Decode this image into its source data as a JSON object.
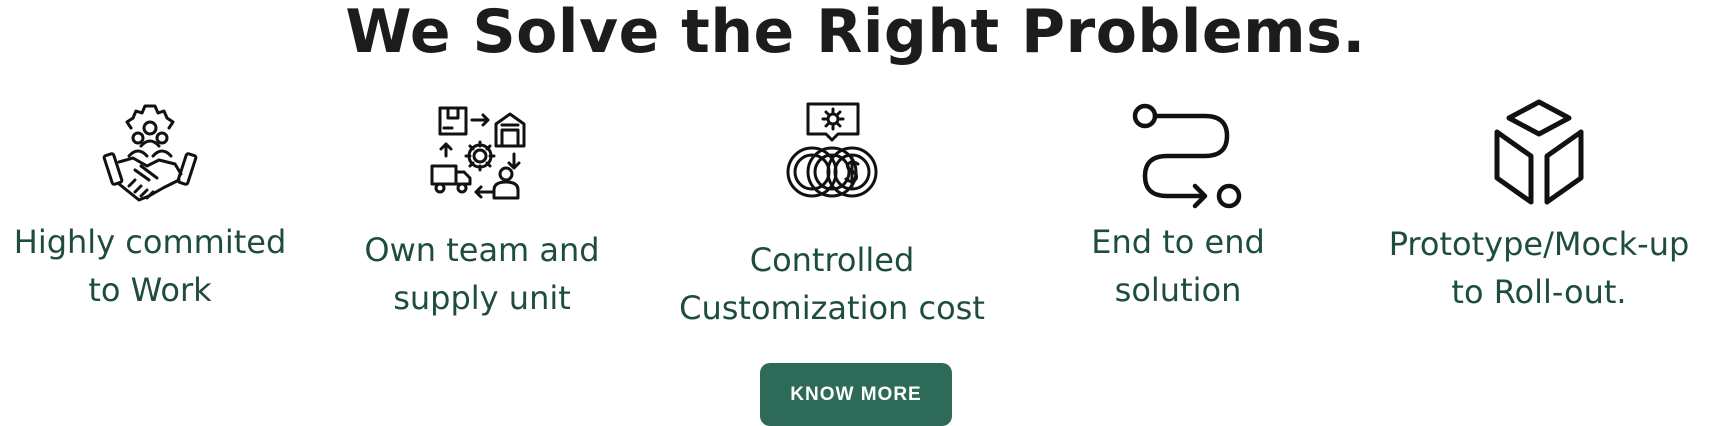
{
  "section": {
    "title": "We Solve the Right Problems."
  },
  "features": [
    {
      "icon": "teamwork-handshake-icon",
      "label_line1": "Highly commited",
      "label_line2": "to Work"
    },
    {
      "icon": "supply-chain-icon",
      "label_line1": "Own team and",
      "label_line2": "supply unit"
    },
    {
      "icon": "coins-cost-icon",
      "label_line1": "Controlled",
      "label_line2": "Customization cost"
    },
    {
      "icon": "route-path-icon",
      "label_line1": "End to end",
      "label_line2": "solution"
    },
    {
      "icon": "cube-prototype-icon",
      "label_line1": "Prototype/Mock-up",
      "label_line2": "to Roll-out."
    }
  ],
  "cta": {
    "label": "KNOW MORE"
  },
  "colors": {
    "heading": "#1c1c1c",
    "label": "#1e4d3d",
    "button_bg": "#2d6a57",
    "button_text": "#ffffff"
  }
}
